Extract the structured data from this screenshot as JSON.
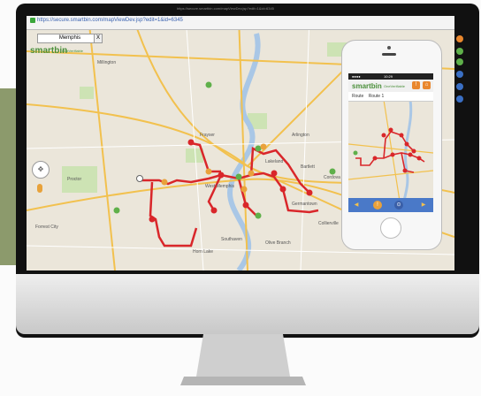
{
  "browser": {
    "url": "https://secure.smartbin.com/mapViewDev.jsp?edit=1&id=6345",
    "tab_title": "https://secure.smartbin.com/mapViewDev.jsp?edit=1&id=6345"
  },
  "map_toolbar": {
    "city_select": "Memphis",
    "close_label": "X",
    "logo": "smartbin",
    "logo_suffix": "OneVerifiable"
  },
  "map": {
    "labels": [
      "Millington",
      "Bartlett",
      "Cordova",
      "Germantown",
      "Collierville",
      "Southaven",
      "Olive Branch",
      "West Memphis",
      "Horn Lake",
      "Frayser",
      "Lakeland",
      "Arlington",
      "Forrest City",
      "Proctor"
    ],
    "navigation_control_glyph": "✥"
  },
  "phone": {
    "status_left": "●●●●",
    "status_time": "10:29",
    "logo": "smartbin",
    "logo_suffix": "OneVerifiable",
    "route_label": "Route",
    "route_value": "Route 1",
    "icon_alert": "!",
    "icon_home": "⌂",
    "bottom_buttons": [
      "◀",
      "!",
      "⊙",
      "▶"
    ]
  },
  "colors": {
    "route": "#d9262a",
    "marker_red": "#d9262a",
    "marker_orange": "#e9a13b",
    "marker_green": "#5fb04a",
    "road_major": "#f2c14e",
    "water": "#a9c7e6",
    "park": "#cde3b4"
  }
}
